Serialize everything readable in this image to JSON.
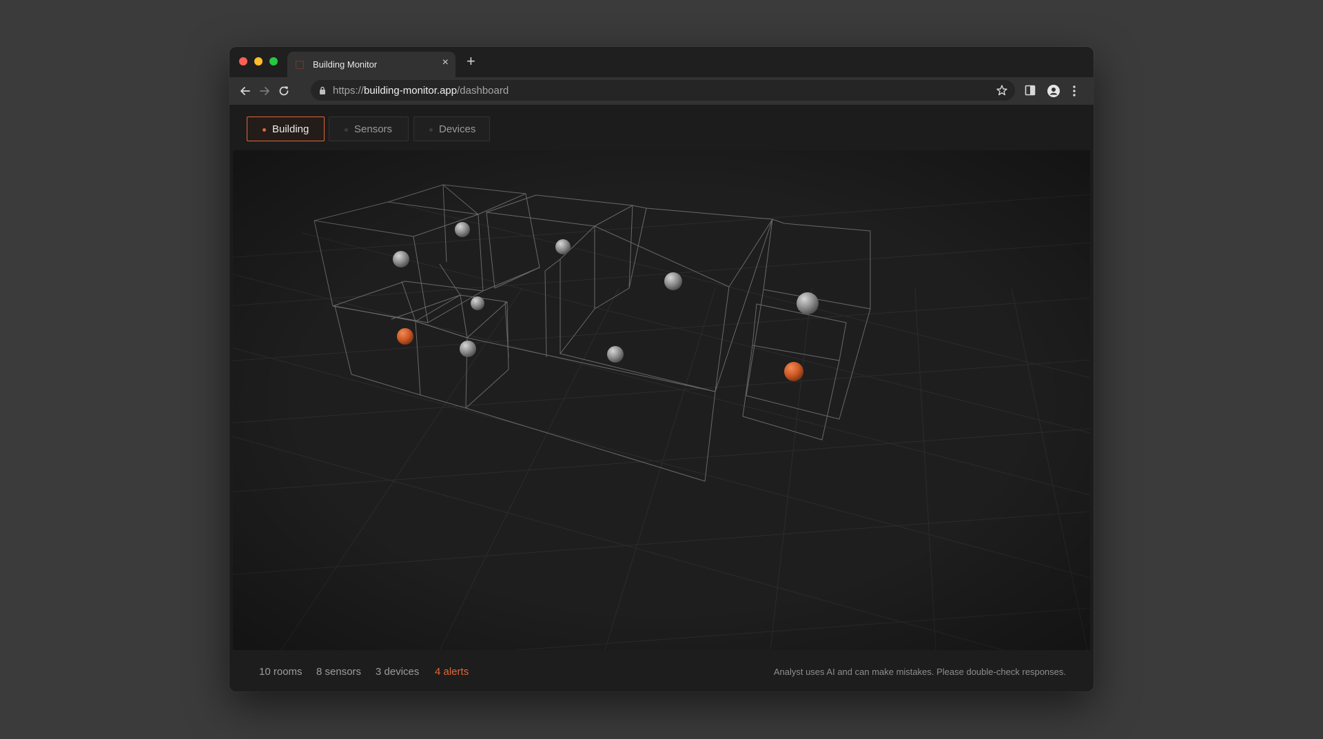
{
  "browser": {
    "tab_title": "Building Monitor",
    "url_scheme": "https://",
    "url_host": "building-monitor.app",
    "url_path": "/dashboard"
  },
  "view_tabs": [
    {
      "label": "Building",
      "active": true
    },
    {
      "label": "Sensors",
      "active": false
    },
    {
      "label": "Devices",
      "active": false
    }
  ],
  "footer": {
    "rooms": "10 rooms",
    "sensors": "8 sensors",
    "devices": "3 devices",
    "alerts": "4 alerts",
    "disclaimer": "Analyst uses AI and can make mistakes. Please double-check responses."
  },
  "colors": {
    "accent": "#e0683a",
    "sensor_normal": "#8a8a8a",
    "sensor_alert": "#d9602a",
    "wireframe": "#6a6a6a",
    "grid": "#2c2c2c"
  },
  "sensors": [
    {
      "status": "normal"
    },
    {
      "status": "normal"
    },
    {
      "status": "normal"
    },
    {
      "status": "normal"
    },
    {
      "status": "normal"
    },
    {
      "status": "normal"
    },
    {
      "status": "normal"
    },
    {
      "status": "normal"
    },
    {
      "status": "alert"
    },
    {
      "status": "alert"
    }
  ]
}
